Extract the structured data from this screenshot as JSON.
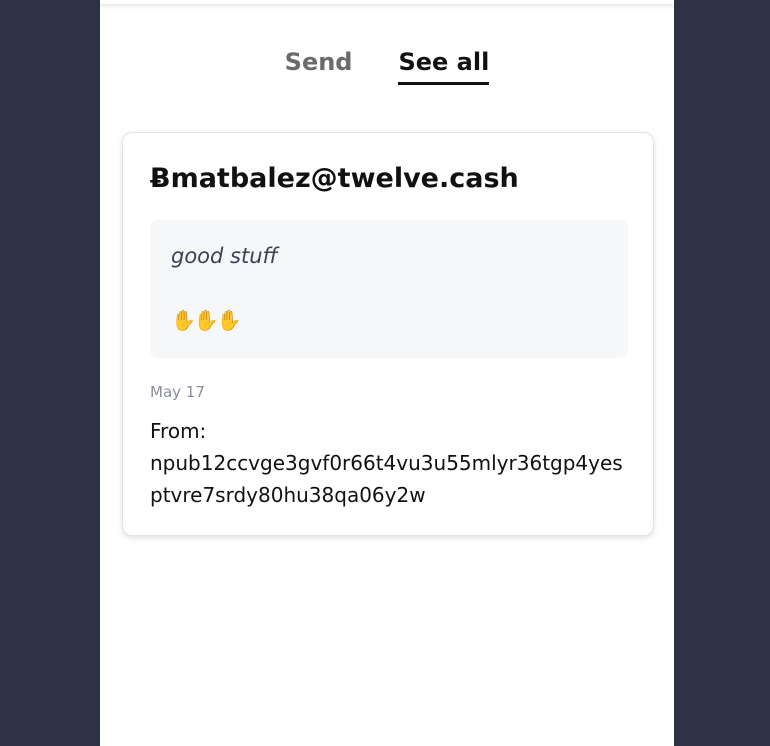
{
  "tabs": [
    {
      "label": "Send",
      "active": false
    },
    {
      "label": "See all",
      "active": true
    }
  ],
  "card": {
    "title": "Ƀmatbalez@twelve.cash",
    "message": "good stuff",
    "emoji": "✋✋✋",
    "date": "May 17",
    "from_label": "From:",
    "from_value": "npub12ccvge3gvf0r66t4vu3u55mlyr36tgp4yesptvre7srdy80hu38qa06y2w"
  },
  "colors": {
    "background": "#2e3245",
    "panel": "#ffffff",
    "active_tab": "#111111",
    "inactive_tab": "#6b6b6b",
    "message_box": "#f6f7f9",
    "date_text": "#8a8f9a"
  }
}
